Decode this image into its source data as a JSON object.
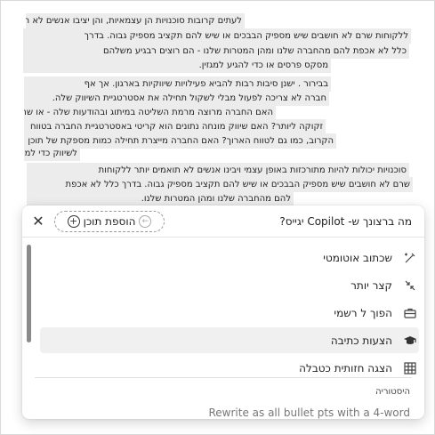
{
  "document": {
    "paragraphs": [
      {
        "lines": [
          "לעתים קרובות סוכנויות הן עצמאיות, והן יציבו אנשים לא תואמים יותר",
          "ללקוחות שרם לא חושבים שיש מספיק הבבכים או שיש להם תקציב מספיק גבוה. בדרך",
          "כלל לא אכפת להם מהחברה שלנו ומהן המטרות שלנו - הם רוצים רבגיע משלהם",
          "מסקס פרסים או כדי להגיע למגזין."
        ]
      },
      {
        "lines": [
          "בבירור . ישנן סיבות רבות להביא פעילויות שיווקיות בארגון. אך אף",
          "חברה לא צריכה לפעול מבלי לשקול תחילה את אסטרטגיית השיווק שלה.",
          "האם החברה מרוצה מרמת השליטה במיתוג ובהודעות שלה - או שהיא",
          "זקוקה ליותר? האם שיווק מונחה נתונים הוא קריטי באסטרטגיית החברה בטווח",
          "הקרוב, כמו גם לטווח הארוך? האם החברה מייצרת תחילה כמות מספקת של תוכן",
          "לשיווק כדי למנף?"
        ]
      },
      {
        "lines": [
          "סוכנויות יכולות להיות מתורכזות באופן עצמי ויבינו אנשים לא תואמים יותר ללקוחות",
          "שרם לא חושבים שיש מספיק הבבכים או שיש להם תקציב מספיק גבוה. בדרך כלל לא אכפת",
          "להם מהחברה שלנו ומהן המטרות שלנו."
        ]
      }
    ]
  },
  "copilot": {
    "prompt_text": "מה ברצונך ש- Copilot יגייס?",
    "add_content_label": "הוספת תוכן",
    "close_icon": "close-icon",
    "menu_items": [
      {
        "label": "שכתוב אוטומטי",
        "icon": "rewrite-icon"
      },
      {
        "label": "קצר יותר",
        "icon": "shrink-icon"
      },
      {
        "label": "הפוך ל רשמי",
        "icon": "briefcase-icon"
      },
      {
        "label": "הצעות כתיבה",
        "icon": "graduation-icon",
        "selected": true
      },
      {
        "label": "הצגה חזותית כטבלה",
        "icon": "table-icon"
      }
    ],
    "history_label": "היסטוריה",
    "history_item": "Rewrite as all bullet pts with a 4-word"
  }
}
